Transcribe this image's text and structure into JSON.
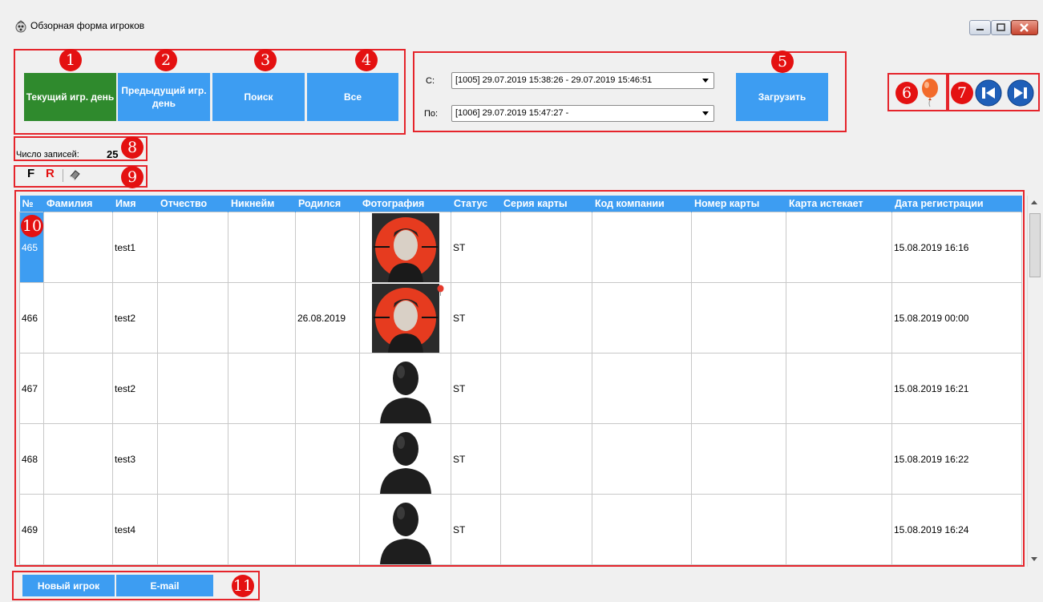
{
  "window": {
    "title": "Обзорная форма игроков"
  },
  "toolbar": {
    "current_day": "Текущий игр. день",
    "previous_day": "Предыдущий игр. день",
    "search": "Поиск",
    "all": "Все",
    "from_label": "С:",
    "from_value": "[1005] 29.07.2019 15:38:26 - 29.07.2019 15:46:51",
    "to_label": "По:",
    "to_value": "[1006] 29.07.2019 15:47:27 -",
    "load": "Загрузить"
  },
  "records": {
    "label": "Число записей:",
    "count": "25"
  },
  "filter": {
    "f_label": "F",
    "r_label": "R"
  },
  "badges": [
    "1",
    "2",
    "3",
    "4",
    "5",
    "6",
    "7",
    "8",
    "9",
    "10",
    "11"
  ],
  "grid": {
    "columns": [
      "№",
      "Фамилия",
      "Имя",
      "Отчество",
      "Никнейм",
      "Родился",
      "Фотография",
      "Статус",
      "Серия карты",
      "Код компании",
      "Номер карты",
      "Карта истекает",
      "Дата регистрации"
    ],
    "rows": [
      {
        "num": "465",
        "last": "",
        "first": "test1",
        "middle": "",
        "nick": "",
        "born": "",
        "status": "ST",
        "series": "",
        "company": "",
        "card": "",
        "expires": "",
        "registered": "15.08.2019 16:16",
        "photo": "photo-portrait"
      },
      {
        "num": "466",
        "last": "",
        "first": "test2",
        "middle": "",
        "nick": "",
        "born": "26.08.2019",
        "status": "ST",
        "series": "",
        "company": "",
        "card": "",
        "expires": "",
        "registered": "15.08.2019 00:00",
        "photo": "photo-portrait"
      },
      {
        "num": "467",
        "last": "",
        "first": "test2",
        "middle": "",
        "nick": "",
        "born": "",
        "status": "ST",
        "series": "",
        "company": "",
        "card": "",
        "expires": "",
        "registered": "15.08.2019 16:21",
        "photo": "silhouette"
      },
      {
        "num": "468",
        "last": "",
        "first": "test3",
        "middle": "",
        "nick": "",
        "born": "",
        "status": "ST",
        "series": "",
        "company": "",
        "card": "",
        "expires": "",
        "registered": "15.08.2019 16:22",
        "photo": "silhouette"
      },
      {
        "num": "469",
        "last": "",
        "first": "test4",
        "middle": "",
        "nick": "",
        "born": "",
        "status": "ST",
        "series": "",
        "company": "",
        "card": "",
        "expires": "",
        "registered": "15.08.2019 16:24",
        "photo": "silhouette"
      }
    ]
  },
  "footer": {
    "new_player": "Новый игрок",
    "email": "E-mail"
  },
  "colors": {
    "accent": "#3d9df2",
    "green": "#2f8a2d",
    "annotation": "#e5242b",
    "badge": "#e41111"
  }
}
